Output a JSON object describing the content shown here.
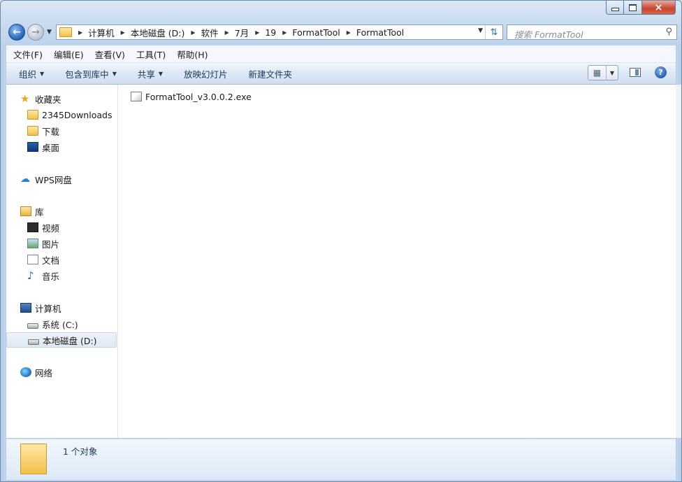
{
  "window": {
    "controls": {
      "minimize": "minimize",
      "maximize": "maximize",
      "close": "×"
    }
  },
  "address_bar": {
    "crumbs": [
      "计算机",
      "本地磁盘 (D:)",
      "软件",
      "7月",
      "19",
      "FormatTool",
      "FormatTool"
    ]
  },
  "search": {
    "placeholder": "搜索 FormatTool"
  },
  "menu": [
    "文件(F)",
    "编辑(E)",
    "查看(V)",
    "工具(T)",
    "帮助(H)"
  ],
  "toolbar": {
    "organize": "组织",
    "include_in_library": "包含到库中",
    "share": "共享",
    "slideshow": "放映幻灯片",
    "new_folder": "新建文件夹"
  },
  "nav": {
    "favorites": "收藏夹",
    "fav_items": [
      "2345Downloads",
      "下载",
      "桌面"
    ],
    "wps": "WPS网盘",
    "libraries": "库",
    "lib_items": [
      "视频",
      "图片",
      "文档",
      "音乐"
    ],
    "computer": "计算机",
    "drives": [
      "系统 (C:)",
      "本地磁盘 (D:)"
    ],
    "network": "网络"
  },
  "files": [
    {
      "name": "FormatTool_v3.0.0.2.exe"
    }
  ],
  "status": {
    "count": "1 个对象"
  }
}
